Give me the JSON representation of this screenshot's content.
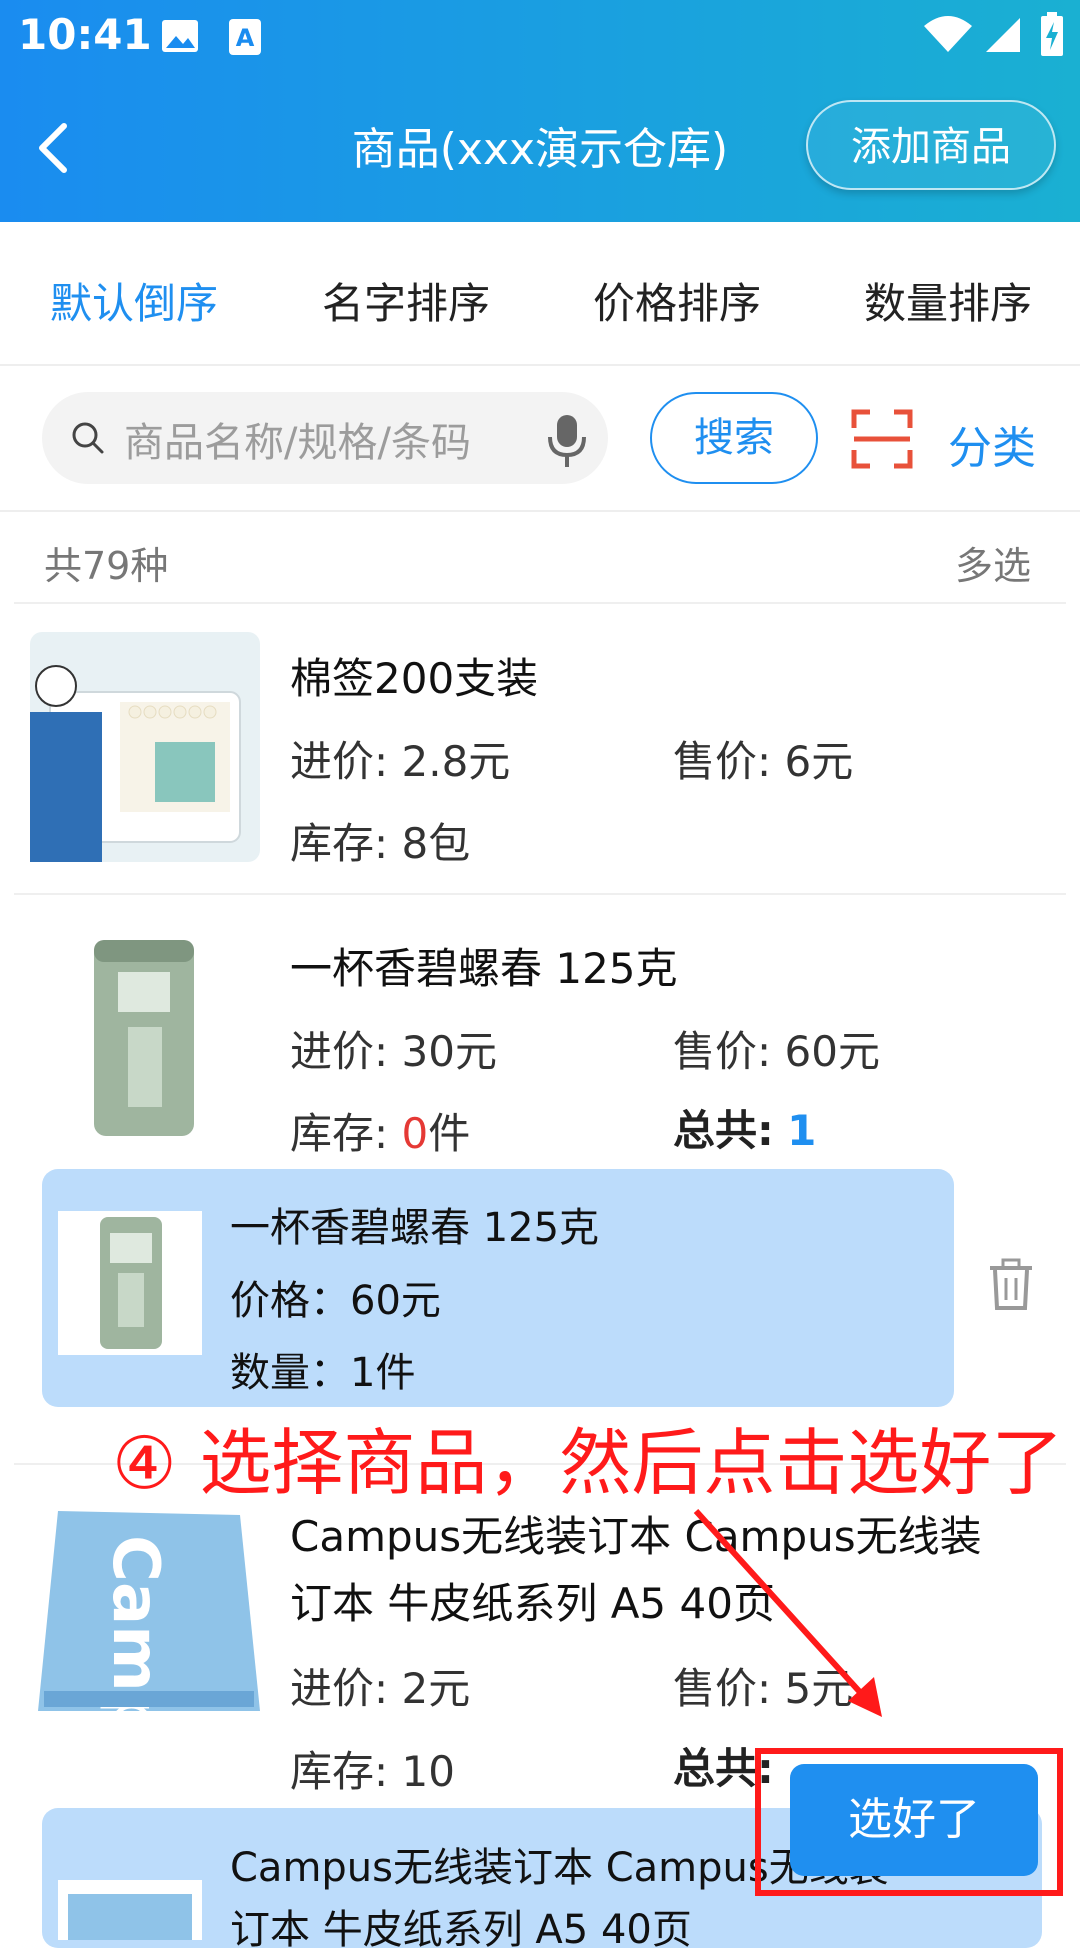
{
  "status_bar": {
    "time": "10:41",
    "icons": [
      "image-icon",
      "a-notification-icon",
      "wifi-icon",
      "signal-icon",
      "battery-charging-icon"
    ]
  },
  "header": {
    "title": "商品(xxx演示仓库)",
    "add_button": "添加商品",
    "back_icon": "chevron-left-icon"
  },
  "sort_tabs": [
    {
      "label": "默认倒序",
      "active": true
    },
    {
      "label": "名字排序",
      "active": false
    },
    {
      "label": "价格排序",
      "active": false
    },
    {
      "label": "数量排序",
      "active": false
    }
  ],
  "search": {
    "placeholder": "商品名称/规格/条码",
    "button": "搜索",
    "category": "分类"
  },
  "summary": {
    "count": "共79种",
    "multi_select": "多选"
  },
  "products": [
    {
      "name": "棉签200支装",
      "cost_label": "进价:",
      "cost": "2.8元",
      "price_label": "售价:",
      "price": "6元",
      "stock_label": "库存:",
      "stock": "8包"
    },
    {
      "name": "一杯香碧螺春  125克",
      "cost_label": "进价:",
      "cost": "30元",
      "price_label": "售价:",
      "price": "60元",
      "stock_label": "库存:",
      "stock_num": "0",
      "stock_unit": "件",
      "total_label": "总共:",
      "total": "1"
    },
    {
      "name_line1": "Campus无线装订本  Campus无线装",
      "name_line2": "订本 牛皮纸系列 A5 40页",
      "cost_label": "进价:",
      "cost": "2元",
      "price_label": "售价:",
      "price": "5元",
      "stock_label": "库存:",
      "stock": "10",
      "total_label": "总共:"
    }
  ],
  "selected_items": [
    {
      "name": "一杯香碧螺春 125克",
      "price": "价格：60元",
      "qty": "数量：1件"
    },
    {
      "name": "Campus无线装订本 Campus无线装",
      "name_line2": "订本 牛皮纸系列 A5 40页"
    }
  ],
  "annotation": {
    "text": "④ 选择商品，然后点击选好了"
  },
  "done_button": "选好了",
  "colors": {
    "accent": "#1f8ff0",
    "annotation": "#ff1a1a",
    "selected_bg": "#bcdcfb"
  }
}
